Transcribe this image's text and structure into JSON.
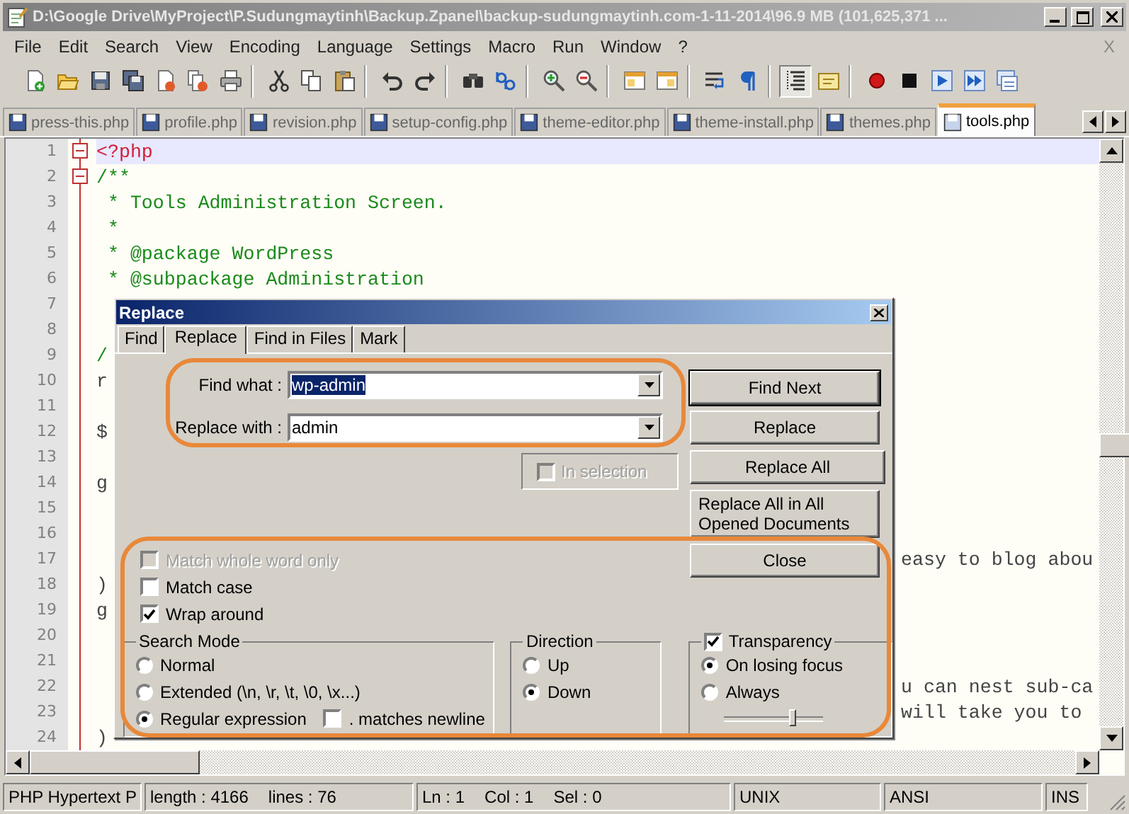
{
  "window": {
    "title": "D:\\Google Drive\\MyProject\\P.Sudungmaytinh\\Backup.Zpanel\\backup-sudungmaytinh.com-1-11-2014\\96.9 MB (101,625,371 ..."
  },
  "menu": {
    "items": [
      "File",
      "Edit",
      "Search",
      "View",
      "Encoding",
      "Language",
      "Settings",
      "Macro",
      "Run",
      "Window",
      "?"
    ],
    "close": "X"
  },
  "toolbar_groups": [
    {
      "buttons": [
        {
          "kind": "new",
          "pressed": false
        },
        {
          "kind": "open",
          "pressed": false
        },
        {
          "kind": "save",
          "pressed": false
        },
        {
          "kind": "save-all",
          "pressed": false
        },
        {
          "kind": "close",
          "pressed": false
        },
        {
          "kind": "close-all",
          "pressed": false
        },
        {
          "kind": "print",
          "pressed": false
        }
      ]
    },
    {
      "buttons": [
        {
          "kind": "cut",
          "pressed": false
        },
        {
          "kind": "copy",
          "pressed": false
        },
        {
          "kind": "paste",
          "pressed": false
        }
      ]
    },
    {
      "buttons": [
        {
          "kind": "undo",
          "pressed": false
        },
        {
          "kind": "redo",
          "pressed": false
        }
      ]
    },
    {
      "buttons": [
        {
          "kind": "find",
          "pressed": false
        },
        {
          "kind": "replace",
          "pressed": false
        }
      ]
    },
    {
      "buttons": [
        {
          "kind": "zoom-in",
          "pressed": false
        },
        {
          "kind": "zoom-out",
          "pressed": false
        }
      ]
    },
    {
      "buttons": [
        {
          "kind": "sync-v",
          "pressed": false
        },
        {
          "kind": "sync-h",
          "pressed": false
        }
      ]
    },
    {
      "buttons": [
        {
          "kind": "wrap",
          "pressed": false
        },
        {
          "kind": "all-chars",
          "pressed": false
        }
      ]
    },
    {
      "buttons": [
        {
          "kind": "indent-guide",
          "pressed": true
        },
        {
          "kind": "lang",
          "pressed": false
        }
      ]
    },
    {
      "buttons": [
        {
          "kind": "record",
          "pressed": false
        },
        {
          "kind": "stop",
          "pressed": false
        },
        {
          "kind": "play",
          "pressed": false
        },
        {
          "kind": "play-multi",
          "pressed": false
        },
        {
          "kind": "save-macro",
          "pressed": false
        }
      ]
    }
  ],
  "file_tabs": [
    {
      "label": "press-this.php",
      "selected": false
    },
    {
      "label": "profile.php",
      "selected": false
    },
    {
      "label": "revision.php",
      "selected": false
    },
    {
      "label": "setup-config.php",
      "selected": false
    },
    {
      "label": "theme-editor.php",
      "selected": false
    },
    {
      "label": "theme-install.php",
      "selected": false
    },
    {
      "label": "themes.php",
      "selected": false
    },
    {
      "label": "tools.php",
      "selected": true
    }
  ],
  "editor": {
    "lines": [
      {
        "number": "1",
        "kind": "php_tag",
        "text": "<?php",
        "fold": true,
        "current": true
      },
      {
        "number": "2",
        "kind": "comment",
        "text": "/**",
        "fold": true,
        "current": false
      },
      {
        "number": "3",
        "kind": "comment",
        "text": " * Tools Administration Screen.",
        "fold": false,
        "current": false
      },
      {
        "number": "4",
        "kind": "comment",
        "text": " *",
        "fold": false,
        "current": false
      },
      {
        "number": "5",
        "kind": "comment",
        "text": " * @package WordPress",
        "fold": false,
        "current": false
      },
      {
        "number": "6",
        "kind": "comment",
        "text": " * @subpackage Administration",
        "fold": false,
        "current": false
      },
      {
        "number": "7",
        "kind": "comment",
        "fold": false,
        "current": false
      },
      {
        "number": "8",
        "kind": "code",
        "fold": false,
        "current": false
      },
      {
        "number": "9",
        "kind": "comment",
        "text": "/",
        "fold": false,
        "current": false
      },
      {
        "number": "10",
        "kind": "code",
        "text": "r",
        "fold": false,
        "current": false
      },
      {
        "number": "11",
        "kind": "code",
        "fold": false,
        "current": false
      },
      {
        "number": "12",
        "kind": "code",
        "text": "$",
        "fold": false,
        "current": false
      },
      {
        "number": "13",
        "kind": "code",
        "fold": false,
        "current": false
      },
      {
        "number": "14",
        "kind": "code",
        "text": "g",
        "fold": false,
        "current": false
      },
      {
        "number": "15",
        "kind": "code",
        "fold": false,
        "current": false
      },
      {
        "number": "16",
        "kind": "code",
        "fold": false,
        "current": false
      },
      {
        "number": "17",
        "kind": "code",
        "right": "easy to blog abou",
        "fold": false,
        "current": false
      },
      {
        "number": "18",
        "kind": "code",
        "text": ")",
        "fold": false,
        "current": false
      },
      {
        "number": "19",
        "kind": "code",
        "text": "g",
        "fold": false,
        "current": false
      },
      {
        "number": "20",
        "kind": "code",
        "fold": false,
        "current": false
      },
      {
        "number": "21",
        "kind": "code",
        "fold": false,
        "current": false
      },
      {
        "number": "22",
        "kind": "code",
        "right": "u can nest sub-ca",
        "fold": false,
        "current": false
      },
      {
        "number": "23",
        "kind": "code",
        "right": "will take you to",
        "fold": false,
        "current": false
      },
      {
        "number": "24",
        "kind": "code",
        "text": ")",
        "fold": false,
        "current": false
      }
    ]
  },
  "dialog": {
    "title": "Replace",
    "tabs": [
      {
        "label": "Find",
        "selected": false
      },
      {
        "label": "Replace",
        "selected": true
      },
      {
        "label": "Find in Files",
        "selected": false
      },
      {
        "label": "Mark",
        "selected": false
      }
    ],
    "find_what": {
      "label": "Find what :",
      "value": "wp-admin",
      "value_selected": true
    },
    "replace_with": {
      "label": "Replace with :",
      "value": "admin",
      "value_selected": false
    },
    "in_selection": {
      "label": "In selection",
      "checked": false,
      "disabled": true
    },
    "buttons": [
      {
        "label": "Find Next",
        "default": true
      },
      {
        "label": "Replace",
        "default": false
      },
      {
        "label": "Replace All",
        "default": false
      },
      {
        "label": "Replace All in All Opened Documents",
        "default": false
      },
      {
        "label": "Close",
        "default": false
      }
    ],
    "options": [
      {
        "label": "Match whole word only",
        "checked": false,
        "disabled": true
      },
      {
        "label": "Match case",
        "checked": false,
        "disabled": false
      },
      {
        "label": "Wrap around",
        "checked": true,
        "disabled": false
      }
    ],
    "search_mode": {
      "title": "Search Mode",
      "options": [
        {
          "label": "Normal",
          "selected": false
        },
        {
          "label": "Extended (\\n, \\r, \\t, \\0, \\x...)",
          "selected": false
        },
        {
          "label": "Regular expression",
          "selected": true
        }
      ],
      "matches_newline": {
        "label": ". matches newline",
        "checked": false
      }
    },
    "direction": {
      "title": "Direction",
      "options": [
        {
          "label": "Up",
          "selected": false
        },
        {
          "label": "Down",
          "selected": true
        }
      ]
    },
    "transparency": {
      "label": "Transparency",
      "checked": true,
      "options": [
        {
          "label": "On losing focus",
          "selected": true
        },
        {
          "label": "Always",
          "selected": false
        }
      ],
      "level": 0.7
    }
  },
  "status_bar": [
    {
      "texts": [
        "PHP Hypertext P"
      ]
    },
    {
      "texts": [
        "length : 4166",
        "lines : 76"
      ]
    },
    {
      "texts": [
        "Ln : 1",
        "Col : 1",
        "Sel : 0"
      ]
    },
    {
      "texts": [
        "UNIX"
      ]
    },
    {
      "texts": [
        "ANSI"
      ]
    },
    {
      "texts": [
        "INS"
      ]
    }
  ]
}
